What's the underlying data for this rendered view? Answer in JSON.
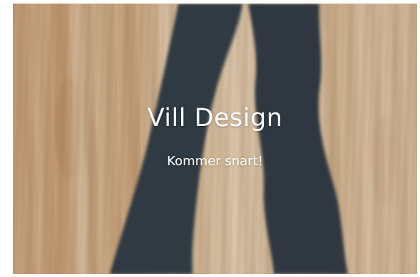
{
  "hero": {
    "title": "Vill Design",
    "subtitle": "Kommer snart!",
    "background_image": "plywood-with-dark-painted-shape",
    "colors": {
      "wood": "#d4b896",
      "shape": "#2f3a44",
      "text": "#ffffff"
    }
  }
}
